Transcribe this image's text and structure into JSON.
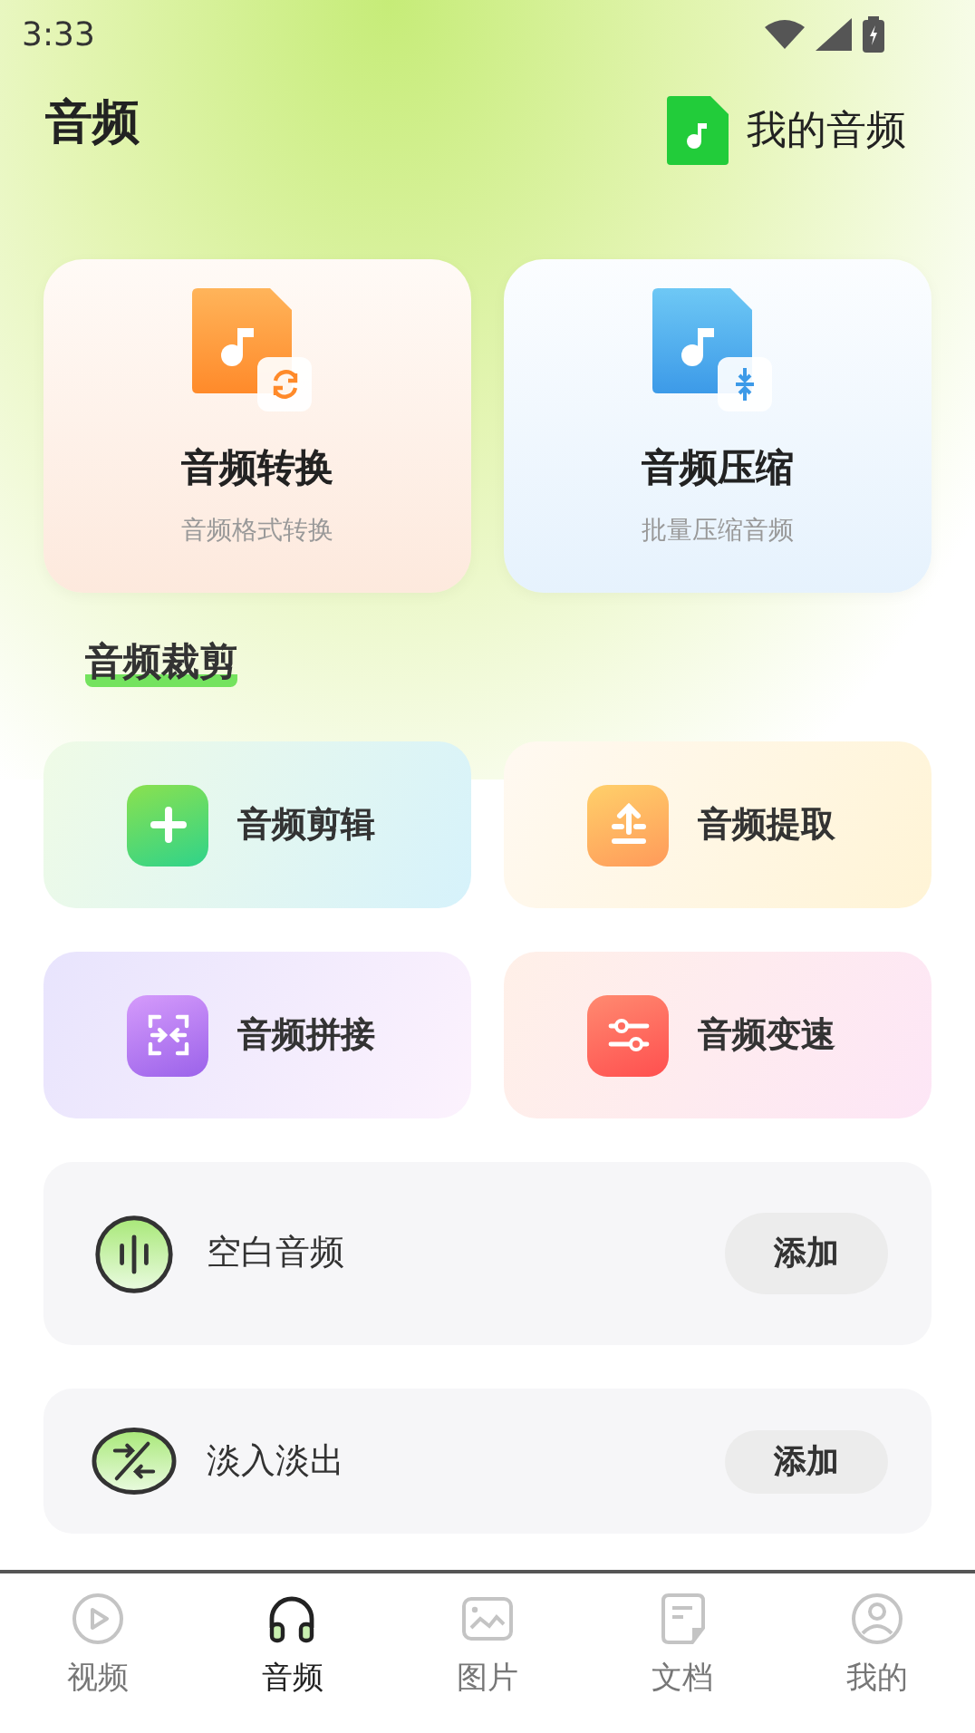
{
  "status_bar": {
    "time": "3:33"
  },
  "header": {
    "title": "音频",
    "my_audio": "我的音频"
  },
  "feature_cards": [
    {
      "kind": "convert",
      "title": "音频转换",
      "subtitle": "音频格式转换"
    },
    {
      "kind": "compress",
      "title": "音频压缩",
      "subtitle": "批量压缩音频"
    }
  ],
  "section": {
    "title": "音频裁剪"
  },
  "tools": [
    {
      "kind": "plus",
      "label": "音频剪辑"
    },
    {
      "kind": "extract",
      "label": "音频提取"
    },
    {
      "kind": "merge",
      "label": "音频拼接"
    },
    {
      "kind": "speed",
      "label": "音频变速"
    }
  ],
  "effects": [
    {
      "kind": "blank",
      "label": "空白音频",
      "button": "添加"
    },
    {
      "kind": "fade",
      "label": "淡入淡出",
      "button": "添加"
    }
  ],
  "tabs": [
    {
      "kind": "video",
      "label": "视频",
      "selected": false
    },
    {
      "kind": "audio",
      "label": "音频",
      "selected": true
    },
    {
      "kind": "image",
      "label": "图片",
      "selected": false
    },
    {
      "kind": "doc",
      "label": "文档",
      "selected": false
    },
    {
      "kind": "me",
      "label": "我的",
      "selected": false
    }
  ]
}
